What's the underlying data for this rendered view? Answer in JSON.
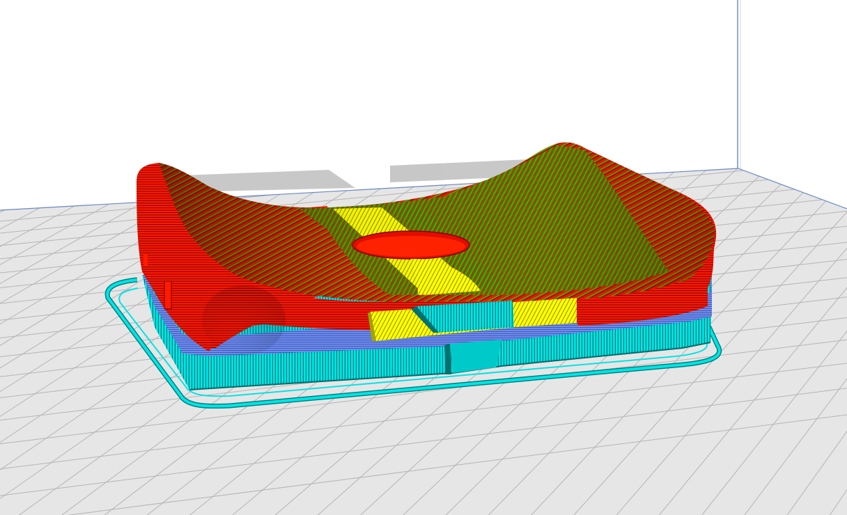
{
  "viewport": {
    "view": "layer-preview",
    "background_color": "#ffffff",
    "build_plate": {
      "surface_color": "#e6e6e6",
      "grid_color": "#b4b4b4",
      "grid_minor_color": "#d2d2d2",
      "back_wall_color": "#ffffff",
      "edge_line_color": "#6a86c4"
    },
    "model_shadow_color": "#b0b0b0",
    "line_type_colors": {
      "outer_wall": "#ff0000",
      "inner_wall": "#00d400",
      "top_bottom": "#ffff00",
      "support": "#00e5e5",
      "skirt_brim": "#00e5e5",
      "support_interface": "#6f8cf0"
    }
  }
}
